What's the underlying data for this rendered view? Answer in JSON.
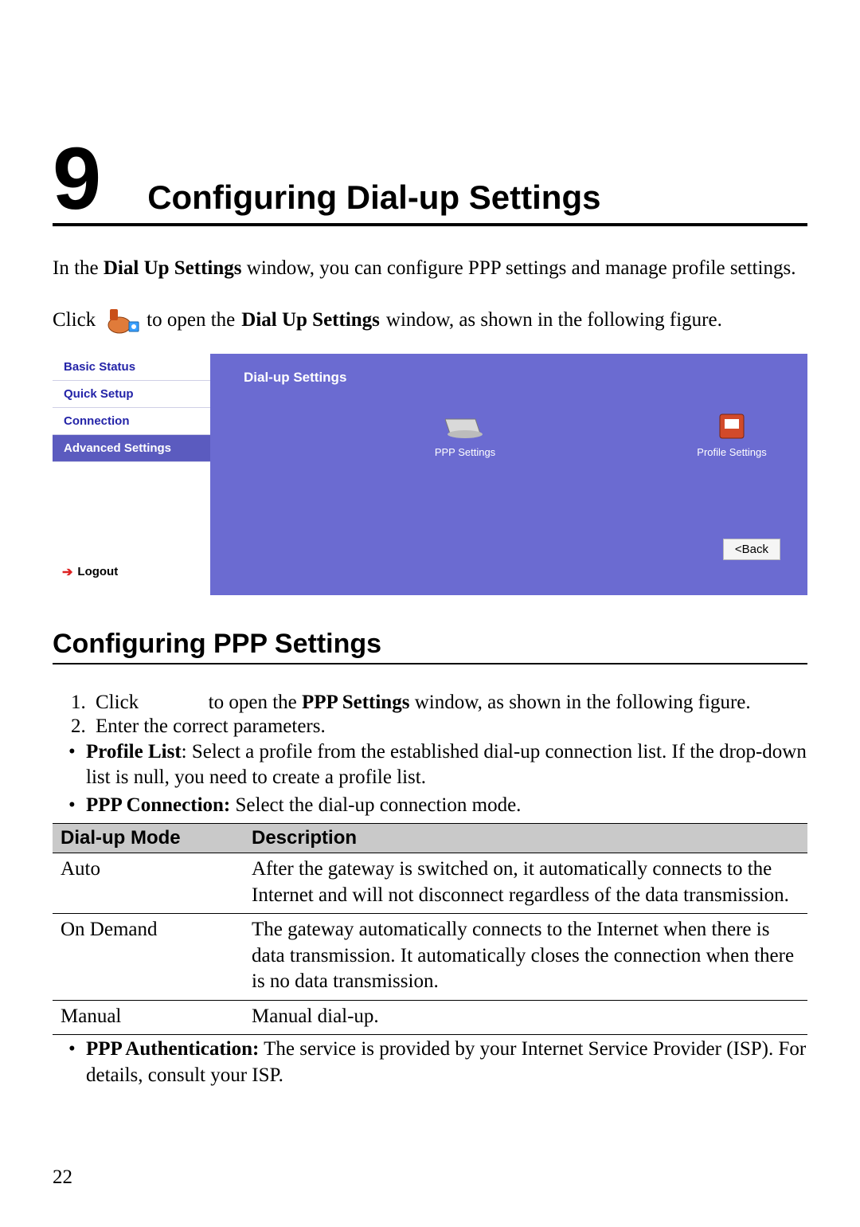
{
  "chapter": {
    "number": "9",
    "title": "Configuring Dial-up Settings"
  },
  "intro": {
    "prefix": "In the ",
    "bold": "Dial Up Settings",
    "suffix": " window, you can configure PPP settings and manage profile settings."
  },
  "click_line": {
    "pre": "Click ",
    "mid": " to open the ",
    "bold": "Dial Up Settings",
    "post": " window, as shown in the following figure."
  },
  "screenshot": {
    "sidebar": {
      "items": [
        {
          "label": "Basic Status",
          "active": false
        },
        {
          "label": "Quick Setup",
          "active": false
        },
        {
          "label": "Connection",
          "active": false
        },
        {
          "label": "Advanced Settings",
          "active": true
        }
      ],
      "logout": "Logout"
    },
    "main": {
      "title": "Dial-up Settings",
      "ppp_label": "PPP Settings",
      "profile_label": "Profile Settings",
      "back_label": "<Back"
    }
  },
  "section_title": "Configuring PPP Settings",
  "steps": {
    "s1_pre": "Click",
    "s1_mid": "to open the ",
    "s1_bold": "PPP Settings",
    "s1_post": " window, as shown in the following figure.",
    "s2": "Enter the correct parameters."
  },
  "bullets": {
    "b1_bold": "Profile List",
    "b1_text": ": Select a profile from the established dial-up connection list. If the drop-down list is null, you need to create a profile list.",
    "b2_bold": "PPP Connection:",
    "b2_text": " Select the dial-up connection mode.",
    "b3_bold": "PPP Authentication:",
    "b3_text": " The service is provided by your Internet Service Provider (ISP). For details, consult your ISP."
  },
  "table": {
    "headers": {
      "mode": "Dial-up Mode",
      "desc": "Description"
    },
    "rows": [
      {
        "mode": "Auto",
        "desc": "After the gateway is switched on, it automatically connects to the Internet and will not disconnect regardless of the data transmission."
      },
      {
        "mode": "On Demand",
        "desc": "The gateway automatically connects to the Internet when there is data transmission. It automatically closes the connection when there is no data transmission."
      },
      {
        "mode": "Manual",
        "desc": "Manual dial-up."
      }
    ]
  },
  "page_number": "22"
}
